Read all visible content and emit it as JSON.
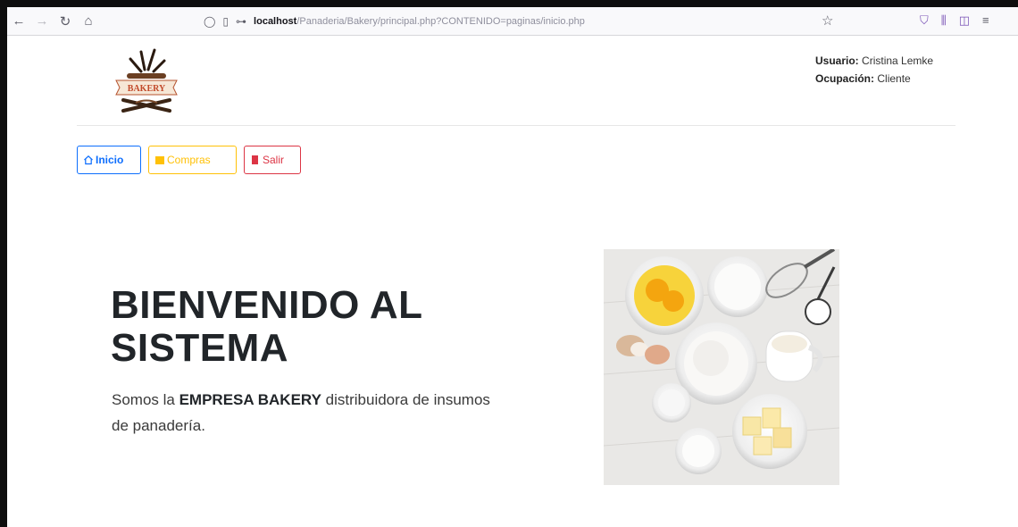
{
  "browser": {
    "url_host": "localhost",
    "url_path": "/Panaderia/Bakery/principal.php?CONTENIDO=paginas/inicio.php"
  },
  "logo": {
    "text": "BAKERY"
  },
  "user": {
    "usuario_label": "Usuario:",
    "usuario_value": "Cristina Lemke",
    "ocupacion_label": "Ocupación:",
    "ocupacion_value": "Cliente"
  },
  "nav": {
    "inicio": "Inicio",
    "compras": "Compras",
    "salir": "Salir"
  },
  "hero": {
    "title": "BIENVENIDO AL SISTEMA",
    "text_before": "Somos la ",
    "text_bold": "EMPRESA BAKERY",
    "text_after": " distribuidora de insumos de panadería."
  },
  "colors": {
    "primary": "#0d6efd",
    "warning": "#ffc107",
    "danger": "#dc3545"
  },
  "icons": {
    "back": "arrow-left-icon",
    "forward": "arrow-right-icon",
    "reload": "reload-icon",
    "home": "home-icon",
    "bookmark": "star-icon"
  }
}
